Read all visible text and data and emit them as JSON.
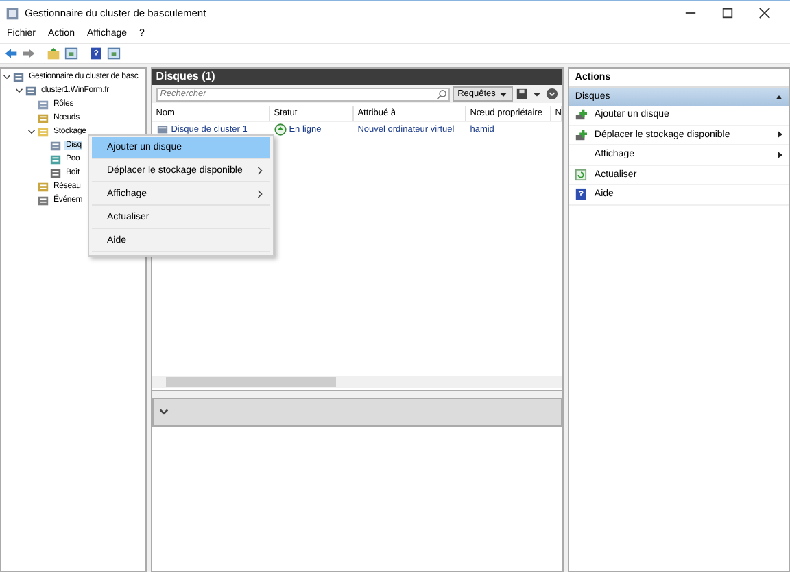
{
  "window": {
    "title": "Gestionnaire du cluster de basculement"
  },
  "menu": [
    "Fichier",
    "Action",
    "Affichage",
    "?"
  ],
  "toolbar": [
    {
      "kind": "back"
    },
    {
      "kind": "forward"
    },
    {
      "kind": "up"
    },
    {
      "kind": "pane"
    },
    {
      "kind": "help"
    },
    {
      "kind": "pane"
    }
  ],
  "tree": [
    {
      "label": "Gestionnaire du cluster de basc",
      "kind": "cluster",
      "expanded": true,
      "selected": false,
      "children": [
        {
          "label": "cluster1.WinForm.fr",
          "kind": "cluster",
          "expanded": true,
          "selected": false,
          "children": [
            {
              "label": "Rôles",
              "kind": "roles",
              "selected": false
            },
            {
              "label": "Nœuds",
              "kind": "nodes",
              "selected": false
            },
            {
              "label": "Stockage",
              "kind": "folder",
              "expanded": true,
              "selected": false,
              "children": [
                {
                  "label": "Disq",
                  "kind": "disk",
                  "selected": true
                },
                {
                  "label": "Poo",
                  "kind": "pool",
                  "selected": false
                },
                {
                  "label": "Boît",
                  "kind": "box",
                  "selected": false
                }
              ]
            },
            {
              "label": "Réseau",
              "kind": "network",
              "selected": false
            },
            {
              "label": "Événem",
              "kind": "events",
              "selected": false
            }
          ]
        }
      ]
    }
  ],
  "context_menu": [
    {
      "label": "Ajouter un disque",
      "submenu": false,
      "selected": true
    },
    {
      "label": "Déplacer le stockage disponible",
      "submenu": true,
      "selected": false
    },
    {
      "label": "Affichage",
      "submenu": true,
      "selected": false
    },
    {
      "label": "Actualiser",
      "submenu": false,
      "selected": false
    },
    {
      "label": "Aide",
      "submenu": false,
      "selected": false
    }
  ],
  "center": {
    "title": "Disques (1)",
    "search": {
      "placeholder": "Rechercher"
    },
    "queries_button": "Requêtes",
    "columns": [
      "Nom",
      "Statut",
      "Attribué à",
      "Nœud propriétaire",
      "N"
    ],
    "rows": [
      {
        "name": "Disque de cluster 1",
        "status": "En ligne",
        "assigned": "Nouvel ordinateur virtuel",
        "owner": "hamid"
      }
    ]
  },
  "actions": {
    "title": "Actions",
    "section": "Disques",
    "items": [
      {
        "label": "Ajouter un disque",
        "kind": "add-disk",
        "submenu": false
      },
      {
        "label": "Déplacer le stockage disponible",
        "kind": "add-disk",
        "submenu": true
      },
      {
        "label": "Affichage",
        "kind": "plain",
        "submenu": true
      },
      {
        "label": "Actualiser",
        "kind": "refresh",
        "submenu": false
      },
      {
        "label": "Aide",
        "kind": "help",
        "submenu": false
      }
    ]
  }
}
